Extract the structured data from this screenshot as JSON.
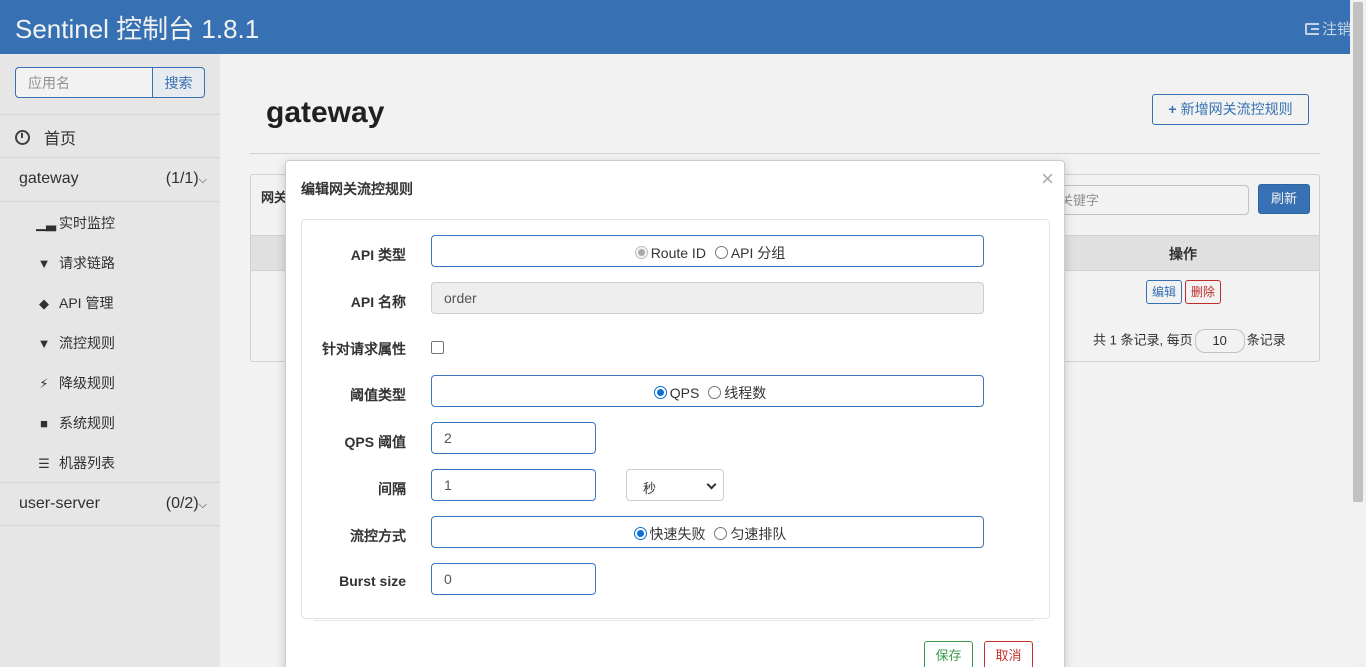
{
  "header": {
    "brand": "Sentinel 控制台 1.8.1",
    "logout_label": "注销"
  },
  "sidebar": {
    "search_placeholder": "应用名",
    "search_button": "搜索",
    "home_label": "首页",
    "apps": [
      {
        "name": "gateway",
        "count": "(1/1)",
        "expanded": true
      },
      {
        "name": "user-server",
        "count": "(0/2)",
        "expanded": false
      }
    ],
    "menu": [
      {
        "label": "实时监控",
        "icon": "bar-chart-icon"
      },
      {
        "label": "请求链路",
        "icon": "filter-icon"
      },
      {
        "label": "API 管理",
        "icon": "tags-icon"
      },
      {
        "label": "流控规则",
        "icon": "filter-icon"
      },
      {
        "label": "降级规则",
        "icon": "flash-icon"
      },
      {
        "label": "系统规则",
        "icon": "lock-icon"
      },
      {
        "label": "机器列表",
        "icon": "list-icon"
      }
    ]
  },
  "main": {
    "title": "gateway",
    "add_button": "新增网关流控规则",
    "panel_head": "网关",
    "keyword_placeholder": "关键字",
    "refresh_button": "刷新",
    "col_ops": "操作",
    "edit_button": "编辑",
    "delete_button": "删除",
    "pager_prefix": "共 1 条记录, 每页",
    "page_size": "10",
    "pager_suffix": "条记录"
  },
  "modal": {
    "title": "编辑网关流控规则",
    "close": "×",
    "api_type_label": "API 类型",
    "api_type_options": [
      "Route ID",
      "API 分组"
    ],
    "api_type_selected": "Route ID",
    "api_name_label": "API 名称",
    "api_name_value": "order",
    "param_item_label": "针对请求属性",
    "param_item_checked": false,
    "grade_label": "阈值类型",
    "grade_options": [
      "QPS",
      "线程数"
    ],
    "grade_selected": "QPS",
    "count_label": "QPS 阈值",
    "count_value": "2",
    "interval_label": "间隔",
    "interval_value": "1",
    "interval_unit": "秒",
    "control_label": "流控方式",
    "control_options": [
      "快速失败",
      "匀速排队"
    ],
    "control_selected": "快速失败",
    "burst_label": "Burst size",
    "burst_value": "0",
    "save_button": "保存",
    "cancel_button": "取消"
  },
  "colors": {
    "header_bg": "#3a78bd",
    "primary": "#3a78bd",
    "success": "#3c9a4c",
    "danger": "#c9302c"
  }
}
